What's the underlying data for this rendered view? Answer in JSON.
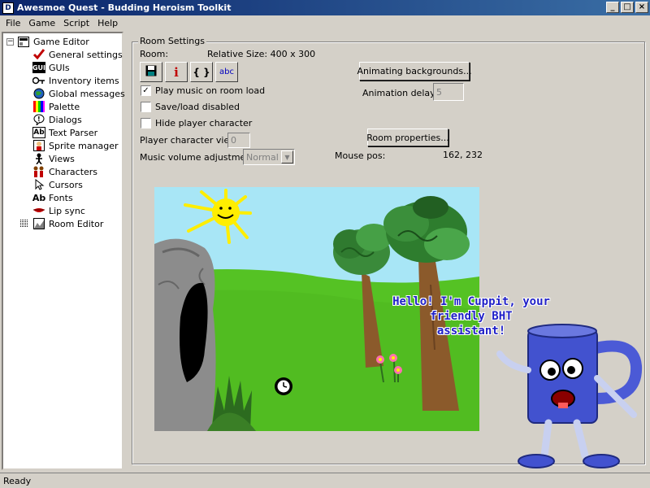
{
  "window": {
    "title": "Awesmoe Quest - Budding Heroism Toolkit",
    "icon": "app-icon"
  },
  "menu": [
    "File",
    "Game",
    "Script",
    "Help"
  ],
  "tree": {
    "root": "Game Editor",
    "items": [
      {
        "label": "General settings",
        "icon": "checkmark-icon"
      },
      {
        "label": "GUIs",
        "icon": "gui-icon"
      },
      {
        "label": "Inventory items",
        "icon": "key-icon"
      },
      {
        "label": "Global messages",
        "icon": "globe-icon"
      },
      {
        "label": "Palette",
        "icon": "palette-icon"
      },
      {
        "label": "Dialogs",
        "icon": "speech-icon"
      },
      {
        "label": "Text Parser",
        "icon": "text-parser-icon"
      },
      {
        "label": "Sprite manager",
        "icon": "sprite-icon"
      },
      {
        "label": "Views",
        "icon": "views-icon"
      },
      {
        "label": "Characters",
        "icon": "characters-icon"
      },
      {
        "label": "Cursors",
        "icon": "cursor-icon"
      },
      {
        "label": "Fonts",
        "icon": "font-icon"
      },
      {
        "label": "Lip sync",
        "icon": "lips-icon"
      }
    ],
    "room_editor": "Room Editor",
    "glyphs": {
      "text_parser": "Ab",
      "fonts": "Ab",
      "gui": "GUI"
    }
  },
  "room_settings": {
    "title": "Room Settings",
    "room_label": "Room:",
    "relative_size": "Relative Size: 400 x 300",
    "toolbar": [
      {
        "name": "save-icon",
        "glyph": ""
      },
      {
        "name": "info-icon",
        "glyph": "i"
      },
      {
        "name": "script-braces-icon",
        "glyph": "{ }"
      },
      {
        "name": "text-abc-icon",
        "glyph": "abc"
      }
    ],
    "play_music": {
      "label": "Play music on room load",
      "checked": true
    },
    "save_load_disabled": {
      "label": "Save/load disabled",
      "checked": false
    },
    "hide_player": {
      "label": "Hide player character",
      "checked": false
    },
    "player_view_label": "Player character view",
    "player_view_value": "0",
    "music_volume_label": "Music volume adjustment",
    "music_volume_value": "Normal",
    "animating_backgrounds_btn": "Animating backgrounds...",
    "animation_delay_label": "Animation delay:",
    "animation_delay_value": "5",
    "room_properties_btn": "Room properties...",
    "mouse_pos_label": "Mouse pos:",
    "mouse_pos_value": "162,  232"
  },
  "assistant": {
    "line1": "Hello! I'm Cuppit, your friendly BHT",
    "line2": "assistant!"
  },
  "status": "Ready",
  "colors": {
    "title_start": "#0a246a",
    "title_end": "#3a6ea5",
    "sky": "#a6e4f6",
    "grass": "#55c224",
    "cave": "#8a8a8a",
    "mug": "#3c4fc8"
  }
}
